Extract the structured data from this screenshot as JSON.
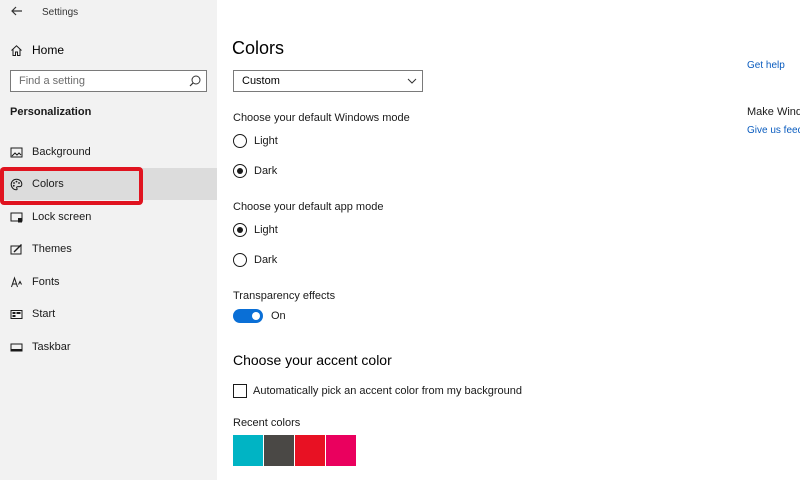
{
  "window": {
    "title": "Settings"
  },
  "sidebar": {
    "home_label": "Home",
    "search_placeholder": "Find a setting",
    "section_title": "Personalization",
    "items": [
      {
        "label": "Background",
        "icon": "image-icon"
      },
      {
        "label": "Colors",
        "icon": "palette-icon",
        "selected": true
      },
      {
        "label": "Lock screen",
        "icon": "lock-screen-icon"
      },
      {
        "label": "Themes",
        "icon": "themes-brush-icon"
      },
      {
        "label": "Fonts",
        "icon": "fonts-icon"
      },
      {
        "label": "Start",
        "icon": "start-icon"
      },
      {
        "label": "Taskbar",
        "icon": "taskbar-icon"
      }
    ]
  },
  "main": {
    "title": "Colors",
    "color_dropdown": {
      "value": "Custom"
    },
    "windows_mode": {
      "label": "Choose your default Windows mode",
      "options": [
        {
          "label": "Light",
          "checked": false
        },
        {
          "label": "Dark",
          "checked": true
        }
      ]
    },
    "app_mode": {
      "label": "Choose your default app mode",
      "options": [
        {
          "label": "Light",
          "checked": true
        },
        {
          "label": "Dark",
          "checked": false
        }
      ]
    },
    "transparency": {
      "label": "Transparency effects",
      "state_label": "On",
      "on": true
    },
    "accent_heading": "Choose your accent color",
    "auto_accent": {
      "label": "Automatically pick an accent color from my background",
      "checked": false
    },
    "recent_colors": {
      "label": "Recent colors",
      "colors": [
        "#00b4c4",
        "#4a4845",
        "#e81123",
        "#ea005e"
      ]
    }
  },
  "right_panel": {
    "help_link": "Get help",
    "feedback_heading": "Make Windo",
    "feedback_link": "Give us feed"
  },
  "colors": {
    "accent": "#0a6fd6",
    "highlight_frame": "#e0131f",
    "link": "#0a5cbf"
  }
}
